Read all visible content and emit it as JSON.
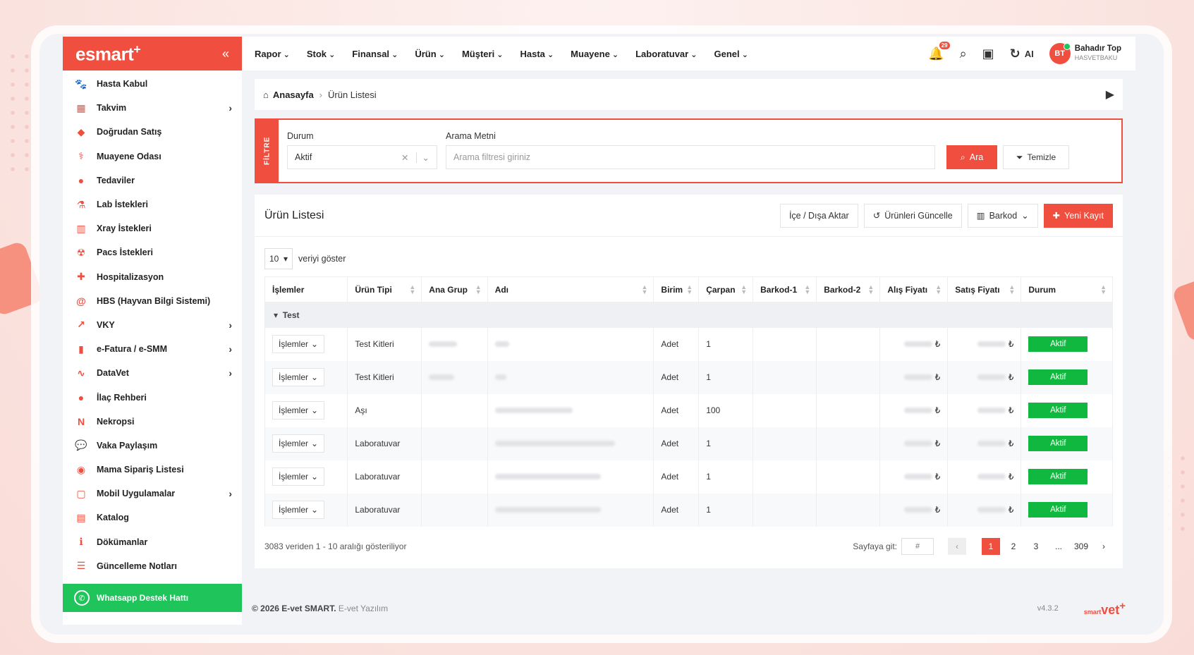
{
  "brand": {
    "logo": "esmart",
    "plus": "+",
    "collapse_icon": "«"
  },
  "sidebar": {
    "items": [
      {
        "label": "Hasta Kabul",
        "icon": "paw-icon",
        "glyph": "🐾",
        "arrow": false
      },
      {
        "label": "Takvim",
        "icon": "calendar-icon",
        "glyph": "▦",
        "arrow": true
      },
      {
        "label": "Doğrudan Satış",
        "icon": "sale-icon",
        "glyph": "◆",
        "arrow": false
      },
      {
        "label": "Muayene Odası",
        "icon": "stethoscope-icon",
        "glyph": "⚕",
        "arrow": false
      },
      {
        "label": "Tedaviler",
        "icon": "pill-icon",
        "glyph": "●",
        "arrow": false
      },
      {
        "label": "Lab İstekleri",
        "icon": "flask-icon",
        "glyph": "⚗",
        "arrow": false
      },
      {
        "label": "Xray İstekleri",
        "icon": "xray-icon",
        "glyph": "▥",
        "arrow": false
      },
      {
        "label": "Pacs İstekleri",
        "icon": "radiation-icon",
        "glyph": "☢",
        "arrow": false
      },
      {
        "label": "Hospitalizasyon",
        "icon": "hospital-icon",
        "glyph": "✚",
        "arrow": false
      },
      {
        "label": "HBS (Hayvan Bilgi Sistemi)",
        "icon": "at-icon",
        "glyph": "@",
        "arrow": false
      },
      {
        "label": "VKY",
        "icon": "chart-icon",
        "glyph": "↗",
        "arrow": true
      },
      {
        "label": "e-Fatura / e-SMM",
        "icon": "invoice-icon",
        "glyph": "▮",
        "arrow": true
      },
      {
        "label": "DataVet",
        "icon": "datavet-icon",
        "glyph": "∿",
        "arrow": true
      },
      {
        "label": "İlaç Rehberi",
        "icon": "medicine-icon",
        "glyph": "●",
        "arrow": false
      },
      {
        "label": "Nekropsi",
        "icon": "n-icon",
        "glyph": "N",
        "arrow": false
      },
      {
        "label": "Vaka Paylaşım",
        "icon": "chat-icon",
        "glyph": "💬",
        "arrow": false
      },
      {
        "label": "Mama Sipariş Listesi",
        "icon": "food-icon",
        "glyph": "◉",
        "arrow": false
      },
      {
        "label": "Mobil Uygulamalar",
        "icon": "tablet-icon",
        "glyph": "▢",
        "arrow": true
      },
      {
        "label": "Katalog",
        "icon": "catalog-icon",
        "glyph": "▤",
        "arrow": false
      },
      {
        "label": "Dökümanlar",
        "icon": "info-icon",
        "glyph": "ℹ",
        "arrow": false
      },
      {
        "label": "Güncelleme Notları",
        "icon": "list-icon",
        "glyph": "☰",
        "arrow": false
      }
    ],
    "whatsapp": "Whatsapp Destek Hattı"
  },
  "topbar": {
    "menu": [
      "Rapor",
      "Stok",
      "Finansal",
      "Ürün",
      "Müşteri",
      "Hasta",
      "Muayene",
      "Laboratuvar",
      "Genel"
    ],
    "notif_count": "29",
    "ai_label": "AI",
    "user": {
      "initials": "BT",
      "name": "Bahadır Top",
      "org": "HASVETBAKU"
    }
  },
  "breadcrumb": {
    "home": "Anasayfa",
    "current": "Ürün Listesi"
  },
  "filter": {
    "tab": "FİLTRE",
    "durum_label": "Durum",
    "durum_value": "Aktif",
    "search_label": "Arama Metni",
    "search_placeholder": "Arama filtresi giriniz",
    "search_btn": "Ara",
    "clear_btn": "Temizle"
  },
  "card": {
    "title": "Ürün Listesi",
    "actions": {
      "import_export": "İçe / Dışa Aktar",
      "update": "Ürünleri Güncelle",
      "barcode": "Barkod",
      "new": "Yeni Kayıt"
    },
    "length_value": "10",
    "length_label": "veriyi göster"
  },
  "table": {
    "columns": [
      "İşlemler",
      "Ürün Tipi",
      "Ana Grup",
      "Adı",
      "Birim",
      "Çarpan",
      "Barkod-1",
      "Barkod-2",
      "Alış Fiyatı",
      "Satış Fiyatı",
      "Durum"
    ],
    "group": "Test",
    "op_label": "İşlemler",
    "currency": "₺",
    "rows": [
      {
        "tip": "Test Kitleri",
        "birim": "Adet",
        "carpan": "1",
        "durum": "Aktif"
      },
      {
        "tip": "Test Kitleri",
        "birim": "Adet",
        "carpan": "1",
        "durum": "Aktif"
      },
      {
        "tip": "Aşı",
        "birim": "Adet",
        "carpan": "100",
        "durum": "Aktif"
      },
      {
        "tip": "Laboratuvar",
        "birim": "Adet",
        "carpan": "1",
        "durum": "Aktif"
      },
      {
        "tip": "Laboratuvar",
        "birim": "Adet",
        "carpan": "1",
        "durum": "Aktif"
      },
      {
        "tip": "Laboratuvar",
        "birim": "Adet",
        "carpan": "1",
        "durum": "Aktif"
      }
    ]
  },
  "pager": {
    "info": "3083 veriden 1 - 10 aralığı gösteriliyor",
    "goto_label": "Sayfaya git:",
    "goto_placeholder": "#",
    "pages": [
      "1",
      "2",
      "3",
      "...",
      "309"
    ],
    "prev": "‹",
    "next": "›"
  },
  "footer": {
    "copy": "© 2026 E-vet SMART.",
    "company": "E-vet Yazılım",
    "version": "v4.3.2",
    "logo_small": "smart",
    "logo_big": "vet",
    "logo_plus": "+"
  },
  "colors": {
    "accent": "#f04e3e",
    "success": "#11b83f",
    "whatsapp": "#1fc55b"
  }
}
